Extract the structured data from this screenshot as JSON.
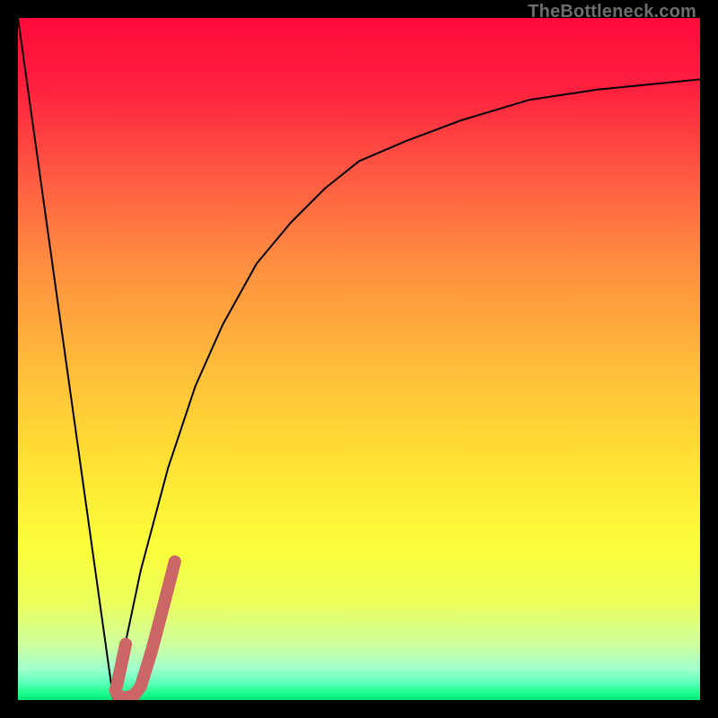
{
  "watermark": "TheBottleneck.com",
  "chart_data": {
    "type": "line",
    "title": "",
    "xlabel": "",
    "ylabel": "",
    "xlim": [
      0,
      100
    ],
    "ylim": [
      0,
      100
    ],
    "grid": false,
    "series": [
      {
        "name": "left-drop",
        "x": [
          0,
          14
        ],
        "y": [
          100,
          0
        ],
        "color": "#000000",
        "width": 2
      },
      {
        "name": "right-curve",
        "x": [
          14,
          18,
          22,
          26,
          30,
          35,
          40,
          45,
          50,
          57,
          65,
          75,
          85,
          95,
          100
        ],
        "y": [
          0,
          19,
          34,
          46,
          55,
          64,
          70,
          75,
          79,
          82,
          85,
          88,
          89.5,
          90.5,
          91
        ],
        "color": "#000000",
        "width": 2
      },
      {
        "name": "j-marker",
        "x": [
          15.8,
          14.6,
          14.3,
          14.6,
          15.6,
          17.0,
          18.0,
          19.6,
          21.0,
          22.0,
          23.0
        ],
        "y": [
          8.2,
          2.6,
          1.4,
          0.7,
          0.3,
          0.7,
          2.0,
          7.2,
          12.5,
          16.4,
          20.3
        ],
        "color": "#cc6666",
        "width": 14
      }
    ],
    "gradient_stops": [
      {
        "offset": 0.0,
        "color": "#ff0a3a"
      },
      {
        "offset": 0.1,
        "color": "#ff1f3e"
      },
      {
        "offset": 0.22,
        "color": "#ff5542"
      },
      {
        "offset": 0.35,
        "color": "#ff8a3f"
      },
      {
        "offset": 0.5,
        "color": "#ffb93a"
      },
      {
        "offset": 0.65,
        "color": "#ffe133"
      },
      {
        "offset": 0.78,
        "color": "#faff3a"
      },
      {
        "offset": 0.86,
        "color": "#eaff5e"
      },
      {
        "offset": 0.92,
        "color": "#ceffa0"
      },
      {
        "offset": 0.955,
        "color": "#9effcd"
      },
      {
        "offset": 0.975,
        "color": "#5cffb8"
      },
      {
        "offset": 0.99,
        "color": "#1aff8c"
      },
      {
        "offset": 1.0,
        "color": "#00e676"
      }
    ]
  }
}
